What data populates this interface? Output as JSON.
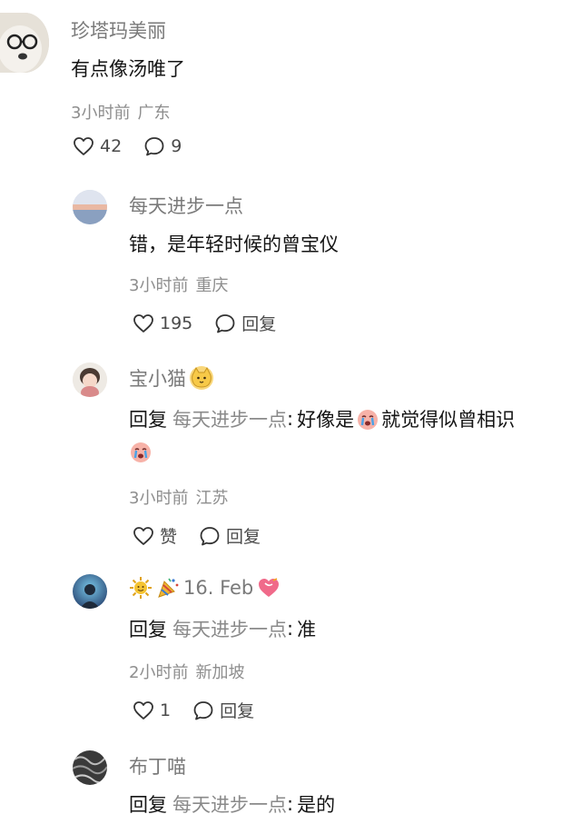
{
  "comments": [
    {
      "username": "珍塔玛美丽",
      "text": "有点像汤唯了",
      "time": "3小时前",
      "location": "广东",
      "likes": "42",
      "replies": "9"
    },
    {
      "username": "每天进步一点",
      "text": "错，是年轻时候的曾宝仪",
      "time": "3小时前",
      "location": "重庆",
      "likes": "195",
      "reply_label": "回复"
    },
    {
      "username": "宝小猫",
      "reply_prefix": "回复",
      "reply_to": "每天进步一点",
      "text_a": "好像是",
      "text_b": "就觉得似曾相识",
      "time": "3小时前",
      "location": "江苏",
      "like_label": "赞",
      "reply_label": "回复"
    },
    {
      "username": "16. Feb",
      "reply_prefix": "回复",
      "reply_to": "每天进步一点",
      "text": "准",
      "time": "2小时前",
      "location": "新加坡",
      "likes": "1",
      "reply_label": "回复"
    },
    {
      "username": "布丁喵",
      "reply_prefix": "回复",
      "reply_to": "每天进步一点",
      "text": "是的"
    }
  ],
  "colors": {
    "username": "#7a7a7a",
    "meta": "#8e8e8e",
    "text": "#151515"
  },
  "icons": [
    "heart-icon",
    "comment-bubble-icon",
    "cat-emoji",
    "crying-emoji",
    "sun-emoji",
    "party-horn-emoji",
    "heart-gift-emoji"
  ]
}
